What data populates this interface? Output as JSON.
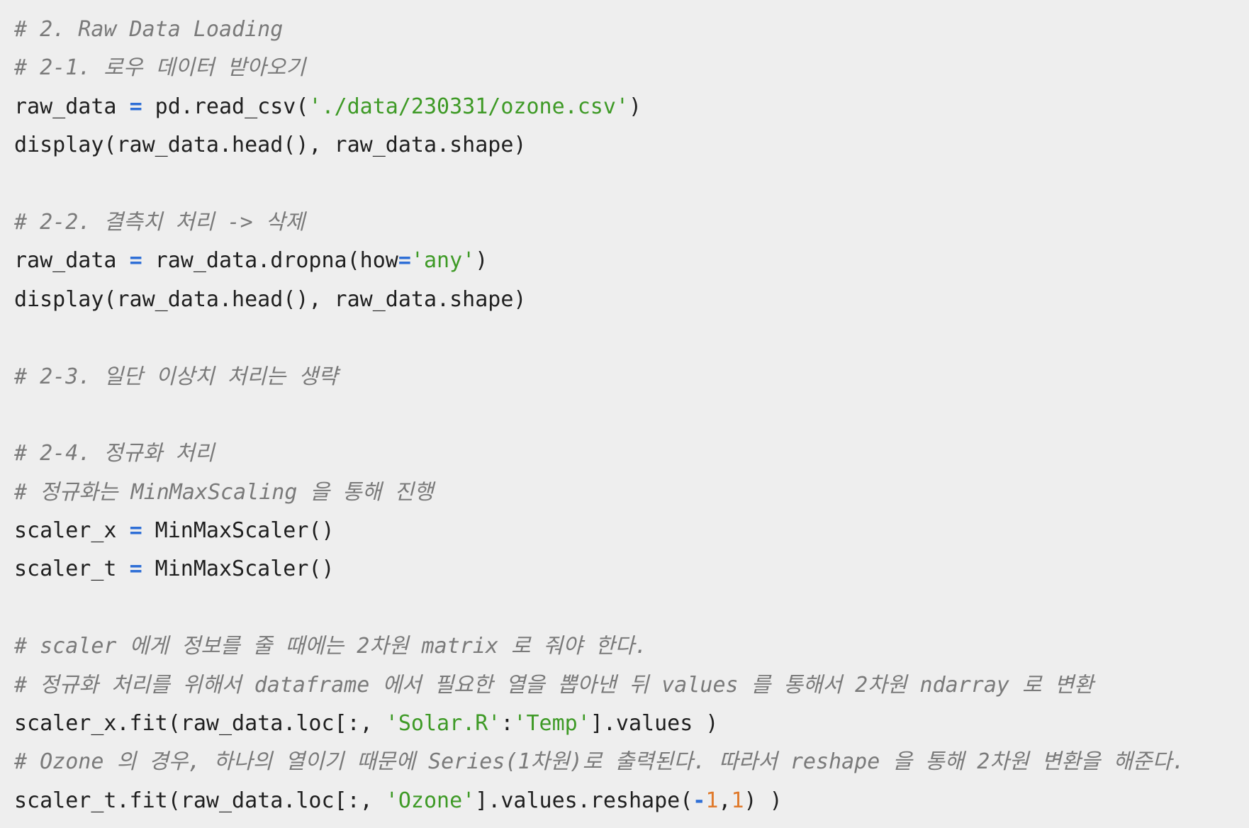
{
  "code": {
    "lines": [
      [
        {
          "t": "c",
          "v": "# 2. Raw Data Loading"
        }
      ],
      [
        {
          "t": "c",
          "v": "# 2-1. 로우 데이터 받아오기"
        }
      ],
      [
        {
          "t": "p",
          "v": "raw_data "
        },
        {
          "t": "o",
          "v": "="
        },
        {
          "t": "p",
          "v": " pd.read_csv("
        },
        {
          "t": "s",
          "v": "'./data/230331/ozone.csv'"
        },
        {
          "t": "p",
          "v": ")"
        }
      ],
      [
        {
          "t": "p",
          "v": "display(raw_data.head(), raw_data.shape)"
        }
      ],
      [],
      [
        {
          "t": "c",
          "v": "# 2-2. 결측치 처리 -> 삭제"
        }
      ],
      [
        {
          "t": "p",
          "v": "raw_data "
        },
        {
          "t": "o",
          "v": "="
        },
        {
          "t": "p",
          "v": " raw_data.dropna(how"
        },
        {
          "t": "o",
          "v": "="
        },
        {
          "t": "s",
          "v": "'any'"
        },
        {
          "t": "p",
          "v": ")"
        }
      ],
      [
        {
          "t": "p",
          "v": "display(raw_data.head(), raw_data.shape)"
        }
      ],
      [],
      [
        {
          "t": "c",
          "v": "# 2-3. 일단 이상치 처리는 생략"
        }
      ],
      [],
      [
        {
          "t": "c",
          "v": "# 2-4. 정규화 처리"
        }
      ],
      [
        {
          "t": "c",
          "v": "# 정규화는 MinMaxScaling 을 통해 진행"
        }
      ],
      [
        {
          "t": "p",
          "v": "scaler_x "
        },
        {
          "t": "o",
          "v": "="
        },
        {
          "t": "p",
          "v": " MinMaxScaler()"
        }
      ],
      [
        {
          "t": "p",
          "v": "scaler_t "
        },
        {
          "t": "o",
          "v": "="
        },
        {
          "t": "p",
          "v": " MinMaxScaler()"
        }
      ],
      [],
      [
        {
          "t": "c",
          "v": "# scaler 에게 정보를 줄 때에는 2차원 matrix 로 줘야 한다."
        }
      ],
      [
        {
          "t": "c",
          "v": "# 정규화 처리를 위해서 dataframe 에서 필요한 열을 뽑아낸 뒤 values 를 통해서 2차원 ndarray 로 변환"
        }
      ],
      [
        {
          "t": "p",
          "v": "scaler_x.fit(raw_data.loc[:, "
        },
        {
          "t": "s",
          "v": "'Solar.R'"
        },
        {
          "t": "p",
          "v": ":"
        },
        {
          "t": "s",
          "v": "'Temp'"
        },
        {
          "t": "p",
          "v": "].values )"
        }
      ],
      [
        {
          "t": "c",
          "v": "# Ozone 의 경우, 하나의 열이기 때문에 Series(1차원)로 출력된다. 따라서 reshape 을 통해 2차원 변환을 해준다."
        }
      ],
      [
        {
          "t": "p",
          "v": "scaler_t.fit(raw_data.loc[:, "
        },
        {
          "t": "s",
          "v": "'Ozone'"
        },
        {
          "t": "p",
          "v": "].values.reshape("
        },
        {
          "t": "o",
          "v": "-"
        },
        {
          "t": "n",
          "v": "1"
        },
        {
          "t": "p",
          "v": ","
        },
        {
          "t": "n",
          "v": "1"
        },
        {
          "t": "p",
          "v": ") )"
        }
      ]
    ]
  },
  "colors": {
    "background": "#eeeeee",
    "plain": "#1f1f1f",
    "comment": "#7a7a7a",
    "operator": "#2f6fd6",
    "string": "#3e9a26",
    "number": "#e07a2c"
  }
}
